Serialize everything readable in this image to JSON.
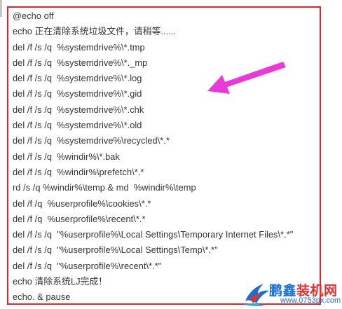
{
  "script": {
    "lines": [
      "@echo off",
      "echo 正在清除系统垃圾文件，请稍等......",
      "del /f /s /q  %systemdrive%\\*.tmp",
      "del /f /s /q  %systemdrive%\\*._mp",
      "del /f /s /q  %systemdrive%\\*.log",
      "del /f /s /q  %systemdrive%\\*.gid",
      "del /f /s /q  %systemdrive%\\*.chk",
      "del /f /s /q  %systemdrive%\\*.old",
      "del /f /s /q  %systemdrive%\\recycled\\*.*",
      "del /f /s /q  %windir%\\*.bak",
      "del /f /s /q  %windir%\\prefetch\\*.*",
      "rd /s /q %windir%\\temp & md  %windir%\\temp",
      "del /f /q  %userprofile%\\cookies\\*.*",
      "del /f /q  %userprofile%\\recent\\*.*",
      "del /f /s /q  \"%userprofile%\\Local Settings\\Temporary Internet Files\\*.*\"",
      "del /f /s /q  \"%userprofile%\\Local Settings\\Temp\\*.*\"",
      "del /f /s /q  \"%userprofile%\\recent\\*.*\"",
      "echo 清除系统LJ完成！",
      "echo. & pause"
    ]
  },
  "annotation": {
    "arrow_color": "#e83ad8",
    "frame_color": "#e5232d"
  },
  "watermark": {
    "title_part1": "鹏鑫",
    "title_part2": "装机网",
    "url": "www.0753px.com",
    "logo_icon": "bird-logo-icon"
  }
}
